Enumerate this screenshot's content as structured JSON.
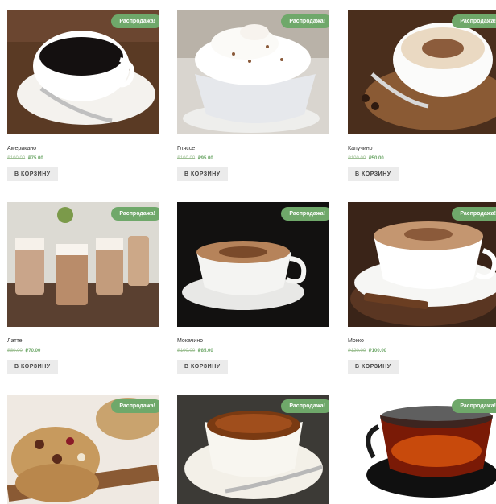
{
  "products": [
    {
      "name": "Американо",
      "old_price": "₽100.00",
      "price": "₽75.00",
      "badge": "Распродажа!",
      "button": "В КОРЗИНУ"
    },
    {
      "name": "Гляссе",
      "old_price": "₽100.00",
      "price": "₽95.00",
      "badge": "Распродажа!",
      "button": "В КОРЗИНУ"
    },
    {
      "name": "Капучино",
      "old_price": "₽100.00",
      "price": "₽50.00",
      "badge": "Распродажа!",
      "button": "В КОРЗИНУ"
    },
    {
      "name": "Латте",
      "old_price": "₽80.00",
      "price": "₽70.00",
      "badge": "Распродажа!",
      "button": "В КОРЗИНУ"
    },
    {
      "name": "Мокачино",
      "old_price": "₽100.00",
      "price": "₽85.00",
      "badge": "Распродажа!",
      "button": "В КОРЗИНУ"
    },
    {
      "name": "Мокко",
      "old_price": "₽120.00",
      "price": "₽100.00",
      "badge": "Распродажа!",
      "button": "В КОРЗИНУ"
    },
    {
      "badge": "Распродажа!"
    },
    {
      "badge": "Распродажа!"
    },
    {
      "badge": "Распродажа!"
    }
  ]
}
